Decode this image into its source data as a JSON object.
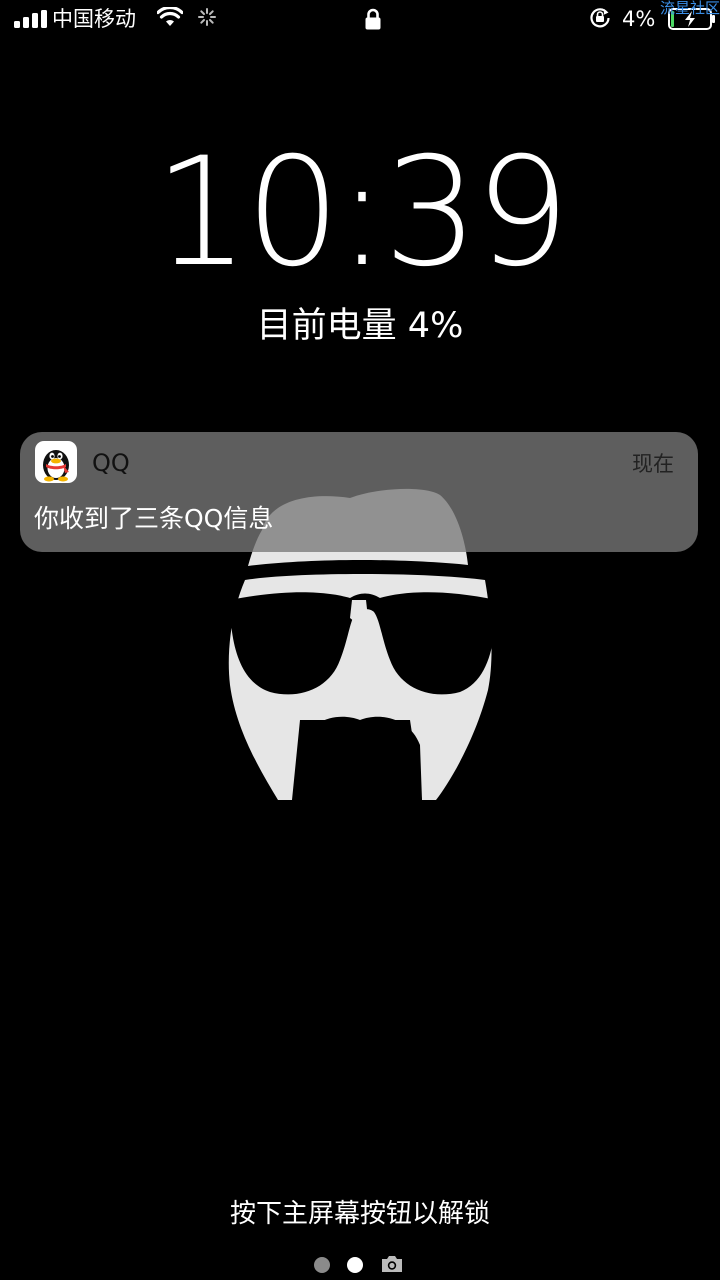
{
  "status_bar": {
    "carrier": "中国移动",
    "battery_percent": "4%",
    "watermark": "流星社区",
    "icons": [
      "signal-icon",
      "wifi-icon",
      "activity-spinner-icon",
      "lock-icon",
      "rotation-lock-icon",
      "battery-charging-icon"
    ]
  },
  "lockscreen": {
    "time": "10:39",
    "battery_label": "目前电量 4%"
  },
  "notification": {
    "app_name": "QQ",
    "time": "现在",
    "message": "你收到了三条QQ信息",
    "icon": "qq-penguin-icon"
  },
  "footer": {
    "unlock_hint": "按下主屏幕按钮以解锁",
    "page_count": 2,
    "current_page": 2,
    "icons": [
      "camera-icon"
    ]
  },
  "colors": {
    "background": "#000000",
    "notification_bg": "#787878",
    "watermark": "#3a8ee6",
    "inactive_dot": "#8a8a8a"
  }
}
